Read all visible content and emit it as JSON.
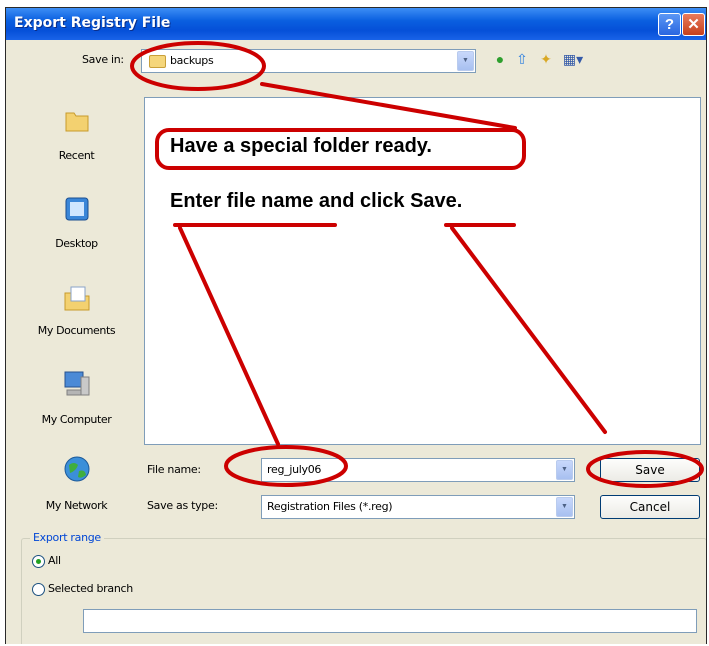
{
  "window": {
    "title": "Export Registry File",
    "help_glyph": "?",
    "close_glyph": "✕"
  },
  "toolbar": {
    "save_in_label": "Save in:",
    "save_in_value": "backups",
    "icons": [
      "back-icon",
      "up-folder-icon",
      "new-folder-icon",
      "views-menu-icon"
    ]
  },
  "places": [
    {
      "label": "Recent",
      "icon": "recent-icon"
    },
    {
      "label": "Desktop",
      "icon": "desktop-icon"
    },
    {
      "label": "My Documents",
      "icon": "my-documents-icon"
    },
    {
      "label": "My Computer",
      "icon": "my-computer-icon"
    },
    {
      "label": "My Network",
      "icon": "my-network-icon"
    }
  ],
  "annotations": {
    "folder_note": "Have a special folder ready.",
    "save_note": "Enter file name and click Save.",
    "color": "#cc0000"
  },
  "form": {
    "filename_label": "File name:",
    "filename_value": "reg_july06",
    "type_label": "Save as type:",
    "type_value": "Registration Files (*.reg)"
  },
  "buttons": {
    "save": "Save",
    "cancel": "Cancel"
  },
  "export_range": {
    "title": "Export range",
    "all_label": "All",
    "branch_label": "Selected branch",
    "selected": "All",
    "branch_value": ""
  }
}
